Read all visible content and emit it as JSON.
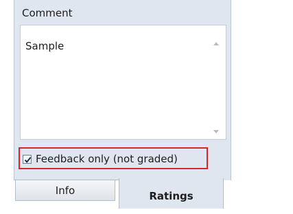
{
  "comment": {
    "label": "Comment",
    "value": "Sample"
  },
  "feedback": {
    "label": "Feedback only (not graded)",
    "checked": true
  },
  "tabs": [
    {
      "label": "Info",
      "active": false
    },
    {
      "label": "Ratings",
      "active": true
    }
  ],
  "colors": {
    "panel_bg": "#dfe6ef",
    "highlight": "#d9242b"
  }
}
